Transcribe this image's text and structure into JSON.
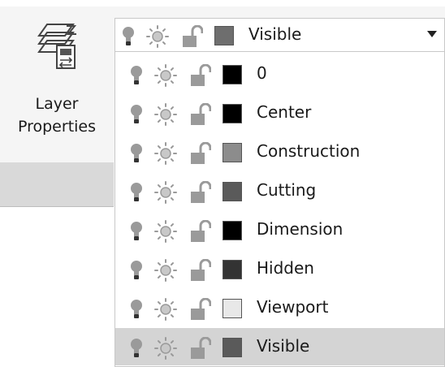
{
  "ribbon": {
    "layer_properties_label": "Layer\nProperties"
  },
  "combo": {
    "selected_label": "Visible",
    "swatch_color": "#6e6e6e"
  },
  "layers": [
    {
      "name": "0",
      "color": "#000000"
    },
    {
      "name": "Center",
      "color": "#000000"
    },
    {
      "name": "Construction",
      "color": "#8c8c8c"
    },
    {
      "name": "Cutting",
      "color": "#5a5a5a"
    },
    {
      "name": "Dimension",
      "color": "#000000"
    },
    {
      "name": "Hidden",
      "color": "#333333"
    },
    {
      "name": "Viewport",
      "color": "#e8e8e8"
    },
    {
      "name": "Visible",
      "color": "#5a5a5a"
    }
  ],
  "selected_index": 7,
  "icons": {
    "bulb": "lightbulb-on-icon",
    "sun": "sun-thawed-icon",
    "lock": "unlocked-icon"
  },
  "colors": {
    "icon_gray": "#9a9a9a",
    "selected_row": "#d4d4d4"
  }
}
